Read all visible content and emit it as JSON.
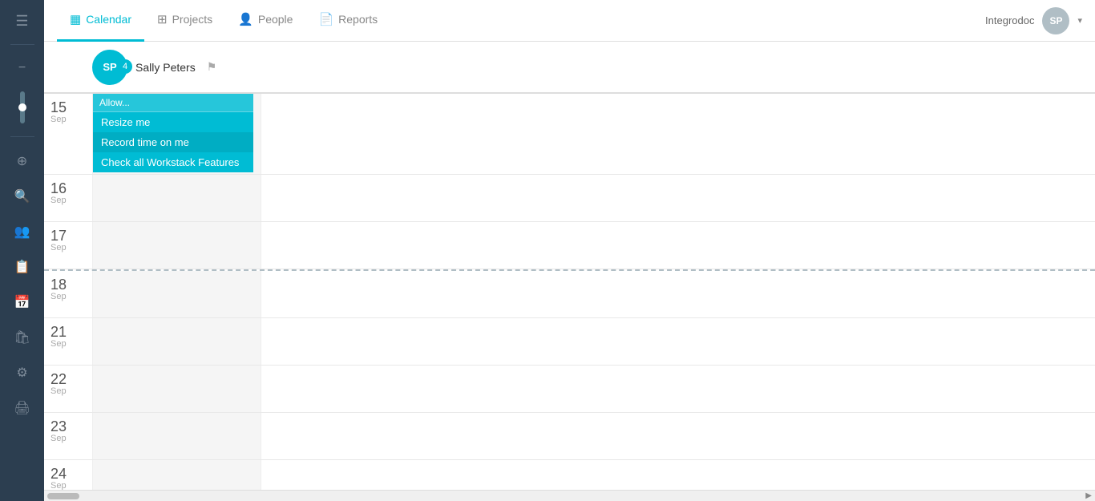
{
  "topnav": {
    "items": [
      {
        "id": "calendar",
        "label": "Calendar",
        "icon": "▦",
        "active": true
      },
      {
        "id": "projects",
        "label": "Projects",
        "icon": "⊞",
        "active": false
      },
      {
        "id": "people",
        "label": "People",
        "icon": "👤",
        "active": false
      },
      {
        "id": "reports",
        "label": "Reports",
        "icon": "📄",
        "active": false
      }
    ],
    "app_name": "Integrodoc",
    "user_initials": "SP",
    "dropdown_arrow": "▾"
  },
  "person": {
    "initials": "SP",
    "name": "Sally Peters",
    "badge_count": "4",
    "pin_icon": "⚑"
  },
  "event": {
    "title": "Allow...",
    "menu_items": [
      {
        "id": "resize",
        "label": "Resize me"
      },
      {
        "id": "record",
        "label": "Record time on me"
      },
      {
        "id": "check",
        "label": "Check all Workstack Features"
      }
    ]
  },
  "calendar_rows": [
    {
      "day": "15",
      "month": "Sep",
      "dashed": false
    },
    {
      "day": "16",
      "month": "Sep",
      "dashed": false
    },
    {
      "day": "17",
      "month": "Sep",
      "dashed": false
    },
    {
      "day": "18",
      "month": "Sep",
      "dashed": true
    },
    {
      "day": "21",
      "month": "Sep",
      "dashed": false
    },
    {
      "day": "22",
      "month": "Sep",
      "dashed": false
    },
    {
      "day": "23",
      "month": "Sep",
      "dashed": false
    },
    {
      "day": "24",
      "month": "Sep",
      "dashed": false
    }
  ],
  "sidebar": {
    "menu_icon": "☰",
    "icons": [
      "−",
      "⊕",
      "⌕",
      "👥",
      "📋",
      "📅",
      "🛍",
      "⚙",
      "🖨"
    ]
  },
  "colors": {
    "accent": "#00bcd4",
    "sidebar_bg": "#2c3e50",
    "active_nav": "#00bcd4"
  }
}
